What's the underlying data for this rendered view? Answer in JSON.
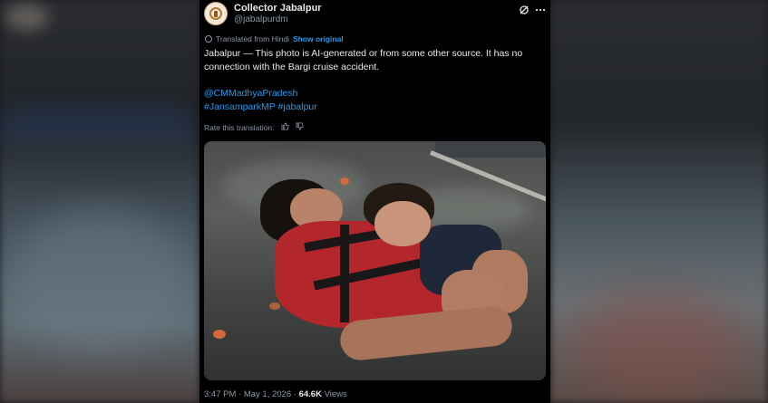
{
  "author": {
    "name": "Collector Jabalpur",
    "handle": "@jabalpurdm"
  },
  "header_icons": [
    "grok-icon",
    "more-icon"
  ],
  "translation": {
    "notice": "Translated from Hindi",
    "show_original": "Show original"
  },
  "tweet_text": "Jabalpur — This photo is AI-generated or from some other source. It has no connection with the Bargi cruise accident.",
  "hashtags": {
    "line1": "@CMMadhyaPradesh",
    "tag1": "#JansamparkMP",
    "tag2": "#jabalpur"
  },
  "rate": {
    "label": "Rate this translation:",
    "up_icon": "thumbs-up-icon",
    "down_icon": "thumbs-down-icon"
  },
  "meta": {
    "time": "3:47 PM",
    "sep1": "·",
    "date": "May 1, 2026",
    "sep2": "·",
    "views_count": "64.6K",
    "views_label": "Views"
  },
  "colors": {
    "link": "#1d9bf0",
    "text": "#e7e9ea",
    "muted": "#8b98a5",
    "background": "#000000"
  }
}
